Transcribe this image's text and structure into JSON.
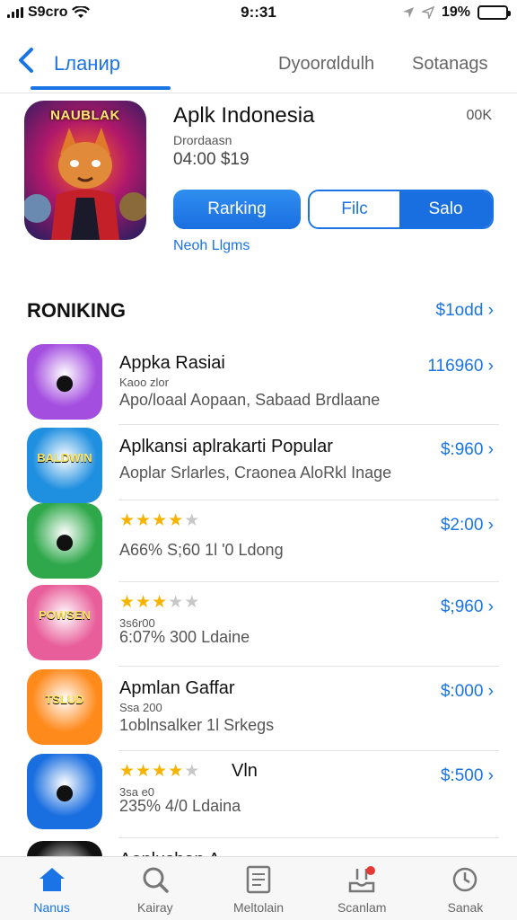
{
  "status_bar": {
    "carrier": "S9cro",
    "time": "9::31",
    "battery": "19%",
    "battery_level": 0.19
  },
  "nav": {
    "title": "Lланир",
    "tabs": [
      "Dyoorαldulh",
      "Sotanags"
    ]
  },
  "featured": {
    "icon_text": "NAUBLAK",
    "title": "Aplk Indonesia",
    "count": "00K",
    "subtitle": "Drordaasn",
    "meta": "04:00  $19",
    "button_primary": "Rarking",
    "segment": [
      "Filc",
      "Salo"
    ],
    "link": "Neoh Llgms"
  },
  "section": {
    "title": "RONIKING",
    "more": "$1odd"
  },
  "apps": [
    {
      "name": "Appka Rasiai",
      "sub1": "Kaoo zlor",
      "sub2": "Apo/loaal Aopaan, Sabaad Brdlaane",
      "price": "116960",
      "icon_bg": "#a44ee0",
      "icon": "fox-face-icon"
    },
    {
      "name": "Aplkansi aplrakarti Popular",
      "sub1": "",
      "sub2": "Aoplar Srlarles, Craonea AloRkl Inage",
      "price": "$:960",
      "icon_bg": "#1f8fe0",
      "icon_text": "BALDWIN",
      "icon": "game-logo-icon"
    },
    {
      "name": "",
      "stars": 4,
      "sub1": "",
      "sub2": "A66%  S;60  1l  '0  Ldong",
      "price": "$2:00",
      "icon_bg": "#2ea84a",
      "icon": "hero-character-icon"
    },
    {
      "name": "",
      "stars": 3,
      "sub1": "3s6r00",
      "sub2": "6:07%  300        Ldaine",
      "price": "$;960",
      "icon_bg": "#e85e9a",
      "icon_text": "POWSEN",
      "icon": "cat-character-icon"
    },
    {
      "name": "Apmlan Gaffar",
      "sub1": "Ssa 200",
      "sub2": "1oblnsalker  1l  Srkegs",
      "price": "$:000",
      "icon_bg": "#ff8a1c",
      "icon_text": "TSLUD",
      "icon": "fox-mascot-icon"
    },
    {
      "name": "Vln",
      "stars": 4,
      "sub1": "3sa e0",
      "sub2": "235%  4/0        Ldaina",
      "price": "$:500",
      "icon_bg": "#1a6fe0",
      "icon": "chicken-face-icon"
    },
    {
      "name": "Aonlushan A",
      "sub1": "",
      "sub2": "",
      "price": "",
      "icon_bg": "#111111",
      "icon": "dark-app-icon"
    }
  ],
  "tabbar": [
    {
      "label": "Nanus",
      "icon": "home-icon",
      "active": true
    },
    {
      "label": "Kairay",
      "icon": "search-icon",
      "active": false
    },
    {
      "label": "Meltolain",
      "icon": "document-icon",
      "active": false
    },
    {
      "label": "Scanlam",
      "icon": "inbox-icon",
      "active": false
    },
    {
      "label": "Sanak",
      "icon": "timer-icon",
      "active": false
    }
  ]
}
